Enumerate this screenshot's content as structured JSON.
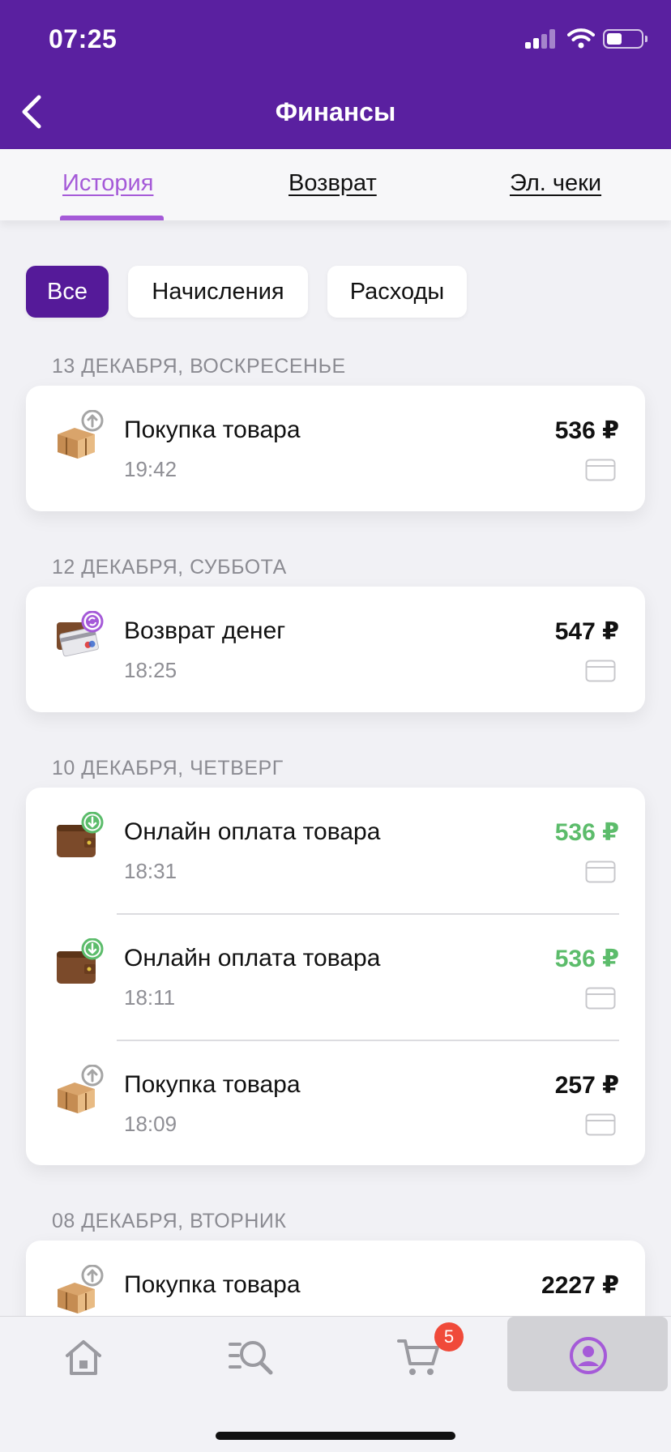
{
  "status_bar": {
    "time": "07:25"
  },
  "header": {
    "title": "Финансы"
  },
  "tabs": [
    {
      "label": "История",
      "active": true
    },
    {
      "label": "Возврат",
      "active": false
    },
    {
      "label": "Эл. чеки",
      "active": false
    }
  ],
  "filters": [
    {
      "label": "Все",
      "active": true
    },
    {
      "label": "Начисления",
      "active": false
    },
    {
      "label": "Расходы",
      "active": false
    }
  ],
  "groups": [
    {
      "date": "13 ДЕКАБРЯ, ВОСКРЕСЕНЬЕ",
      "transactions": [
        {
          "icon": "box-purchase-icon",
          "name": "Покупка товара",
          "time": "19:42",
          "amount": "536 ₽",
          "type": "expense"
        }
      ]
    },
    {
      "date": "12 ДЕКАБРЯ, СУББОТА",
      "transactions": [
        {
          "icon": "refund-card-icon",
          "name": "Возврат денег",
          "time": "18:25",
          "amount": "547 ₽",
          "type": "expense"
        }
      ]
    },
    {
      "date": "10 ДЕКАБРЯ, ЧЕТВЕРГ",
      "transactions": [
        {
          "icon": "wallet-income-icon",
          "name": "Онлайн оплата товара",
          "time": "18:31",
          "amount": "536 ₽",
          "type": "income"
        },
        {
          "icon": "wallet-income-icon",
          "name": "Онлайн оплата товара",
          "time": "18:11",
          "amount": "536 ₽",
          "type": "income"
        },
        {
          "icon": "box-purchase-icon",
          "name": "Покупка товара",
          "time": "18:09",
          "amount": "257 ₽",
          "type": "expense"
        }
      ]
    },
    {
      "date": "08 ДЕКАБРЯ, ВТОРНИК",
      "transactions": [
        {
          "icon": "box-purchase-icon",
          "name": "Покупка товара",
          "time": "",
          "amount": "2227 ₽",
          "type": "expense"
        }
      ]
    }
  ],
  "bottom_nav": {
    "items": [
      {
        "icon": "home-icon",
        "active": false
      },
      {
        "icon": "search-catalog-icon",
        "active": false
      },
      {
        "icon": "cart-icon",
        "active": false,
        "badge": "5"
      },
      {
        "icon": "profile-icon",
        "active": true
      }
    ]
  },
  "colors": {
    "header": "#5a20a0",
    "accent": "#a55ad8",
    "chip_active": "#551a99",
    "income": "#5cbc6b",
    "badge": "#f04a3a"
  }
}
